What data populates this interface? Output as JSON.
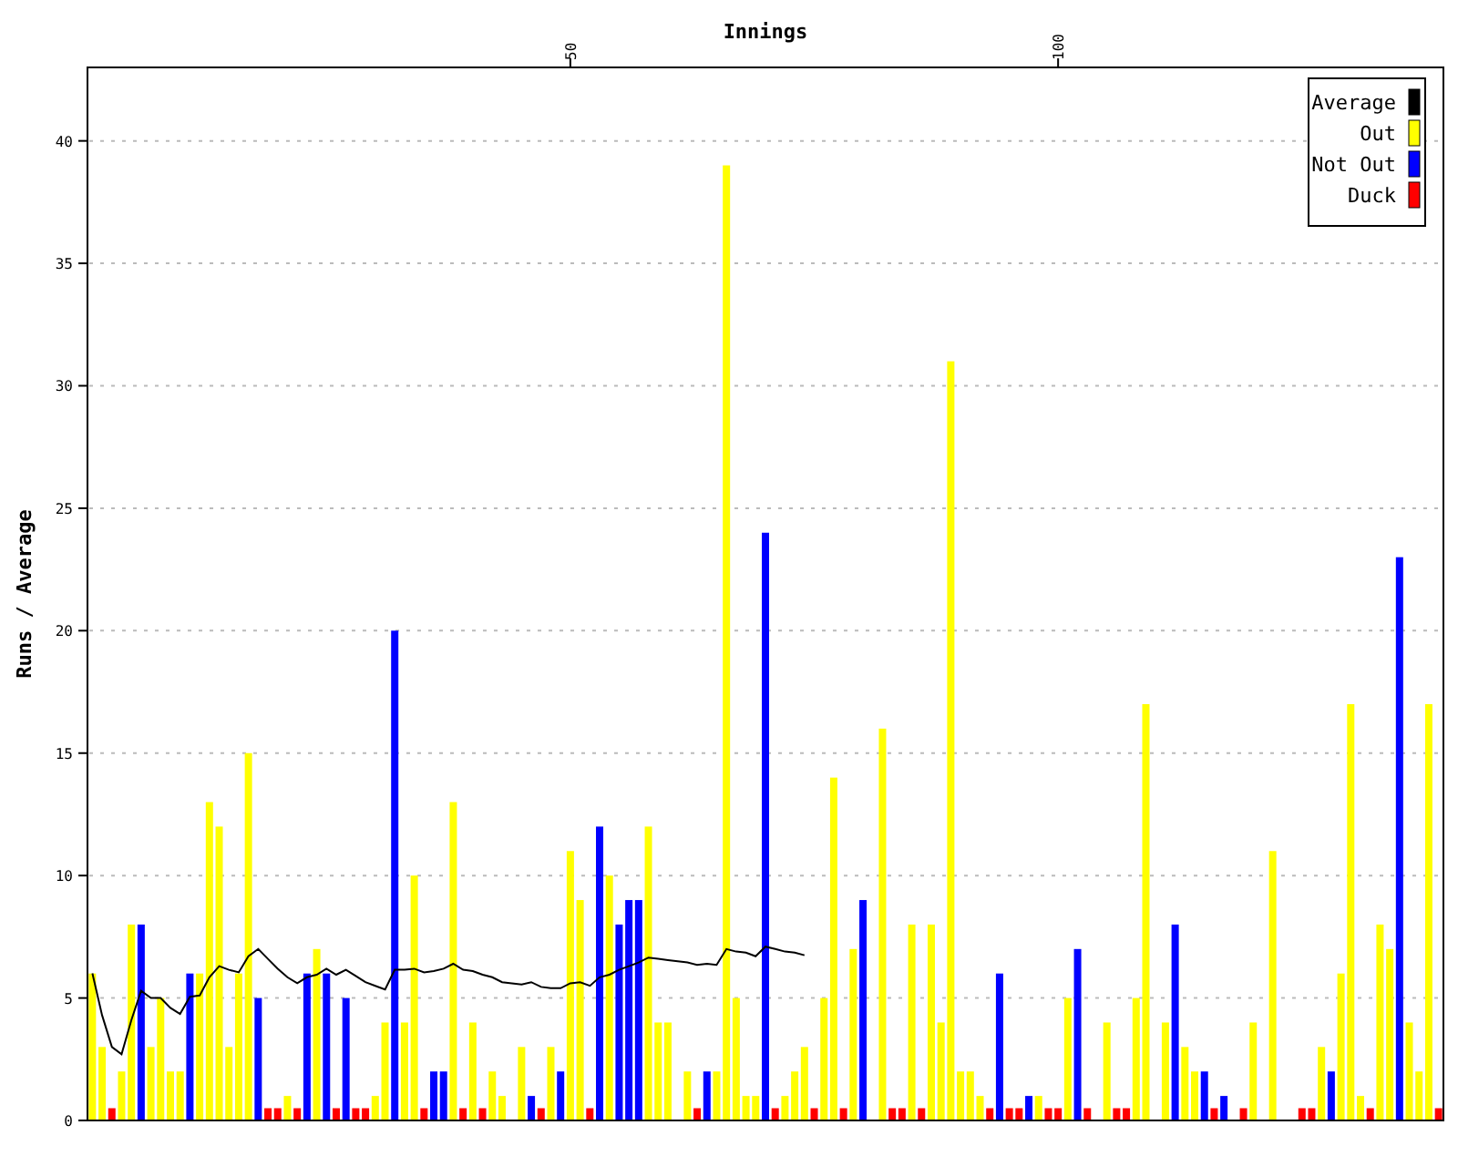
{
  "chart": {
    "chart_data": {
      "type": "bar",
      "xlabel": "Innings",
      "ylabel": "Runs / Average",
      "x": [
        1,
        2,
        3,
        4,
        5,
        6,
        7,
        8,
        9,
        10,
        11,
        12,
        13,
        14,
        15,
        16,
        17,
        18,
        19,
        20,
        21,
        22,
        23,
        24,
        25,
        26,
        27,
        28,
        29,
        30,
        31,
        32,
        33,
        34,
        35,
        36,
        37,
        38,
        39,
        40,
        41,
        42,
        43,
        45,
        46,
        47,
        48,
        49,
        50,
        51,
        52,
        53,
        54,
        55,
        56,
        57,
        58,
        59,
        60,
        62,
        63,
        64,
        65,
        66,
        67,
        68,
        69,
        70,
        71,
        72,
        73,
        74,
        75,
        76,
        77,
        78,
        79,
        80,
        82,
        83,
        84,
        85,
        86,
        87,
        88,
        89,
        90,
        91,
        92,
        93,
        94,
        95,
        96,
        97,
        98,
        99,
        100,
        101,
        102,
        103,
        105,
        106,
        107,
        108,
        109,
        111,
        112,
        113,
        114,
        115,
        116,
        117,
        119,
        120,
        122,
        125,
        126,
        127,
        128,
        129,
        130,
        131,
        132,
        133,
        134,
        135,
        136,
        137,
        138,
        139
      ],
      "xlim": [
        0.5,
        139.5
      ],
      "ylim": [
        0,
        43
      ],
      "xticks": [
        50,
        100
      ],
      "yticks": [
        0,
        5,
        10,
        15,
        20,
        25,
        30,
        35,
        40
      ],
      "grid": true,
      "legend": "upper right",
      "series": [
        {
          "name": "Average",
          "type": "line",
          "color": "#000000",
          "values": [
            6.0,
            4.3,
            3.0,
            2.7,
            4.1,
            5.3,
            5.0,
            5.0,
            4.6,
            4.35,
            5.05,
            5.1,
            5.85,
            6.3,
            6.15,
            6.05,
            6.7,
            7.0,
            6.6,
            6.2,
            5.85,
            5.6,
            5.85,
            5.95,
            6.2,
            5.95,
            6.15,
            5.9,
            5.65,
            5.5,
            5.35,
            6.15,
            6.15,
            6.2,
            6.05,
            6.1,
            6.2,
            6.4,
            6.15,
            6.1,
            5.95,
            5.85,
            5.65,
            5.55,
            5.65,
            5.45,
            5.4,
            5.4,
            5.6,
            5.65,
            5.5,
            5.85,
            5.95,
            6.15,
            6.3,
            6.45,
            6.65,
            6.6,
            6.55,
            6.45,
            6.35,
            6.4,
            6.35,
            7.0,
            6.9,
            6.85,
            6.7,
            7.1,
            7.0,
            6.9,
            6.85,
            6.75,
            null,
            null,
            null,
            null,
            null,
            null,
            null,
            null,
            null,
            null,
            null,
            null,
            null,
            null,
            null,
            null,
            null,
            null,
            null,
            null,
            null,
            null,
            null,
            null,
            null,
            null,
            null,
            null,
            null,
            null,
            null,
            null,
            null,
            null,
            null,
            null,
            null,
            null,
            null,
            null,
            null,
            null,
            null,
            null,
            null,
            null,
            null,
            null,
            null,
            null,
            null,
            null,
            null,
            null,
            null,
            null,
            null,
            null
          ]
        },
        {
          "name": "Out",
          "type": "bar",
          "color": "#ffff00",
          "values": [
            6,
            3,
            null,
            2,
            8,
            null,
            3,
            5,
            2,
            2,
            null,
            6,
            13,
            12,
            3,
            6,
            15,
            null,
            null,
            null,
            1,
            null,
            null,
            7,
            null,
            null,
            null,
            null,
            null,
            1,
            4,
            null,
            4,
            10,
            null,
            null,
            null,
            13,
            null,
            4,
            null,
            2,
            1,
            3,
            null,
            null,
            3,
            null,
            11,
            9,
            null,
            null,
            10,
            null,
            null,
            null,
            12,
            4,
            4,
            2,
            null,
            null,
            2,
            39,
            5,
            1,
            1,
            null,
            null,
            1,
            2,
            3,
            null,
            5,
            14,
            null,
            7,
            null,
            16,
            null,
            null,
            8,
            null,
            8,
            4,
            31,
            2,
            2,
            1,
            null,
            null,
            null,
            null,
            null,
            1,
            null,
            null,
            5,
            null,
            null,
            4,
            null,
            null,
            5,
            17,
            4,
            null,
            3,
            2,
            null,
            null,
            null,
            null,
            4,
            11,
            null,
            null,
            3,
            null,
            6,
            17,
            1,
            null,
            8,
            7,
            null,
            4,
            2,
            17,
            null
          ]
        },
        {
          "name": "Not Out",
          "type": "bar",
          "color": "#0000ff",
          "values": [
            null,
            null,
            null,
            null,
            null,
            8,
            null,
            null,
            null,
            null,
            6,
            null,
            null,
            null,
            null,
            null,
            null,
            5,
            null,
            null,
            null,
            null,
            6,
            null,
            6,
            null,
            5,
            null,
            null,
            null,
            null,
            20,
            null,
            null,
            null,
            2,
            2,
            null,
            null,
            null,
            null,
            null,
            null,
            null,
            1,
            null,
            null,
            2,
            null,
            null,
            null,
            12,
            null,
            8,
            9,
            9,
            null,
            null,
            null,
            null,
            null,
            2,
            null,
            null,
            null,
            null,
            null,
            24,
            null,
            null,
            null,
            null,
            null,
            null,
            null,
            null,
            null,
            9,
            null,
            null,
            null,
            null,
            null,
            null,
            null,
            null,
            null,
            null,
            null,
            null,
            6,
            null,
            null,
            1,
            null,
            null,
            null,
            null,
            7,
            null,
            null,
            null,
            null,
            null,
            null,
            null,
            8,
            null,
            null,
            2,
            null,
            1,
            null,
            null,
            null,
            null,
            null,
            null,
            2,
            null,
            null,
            null,
            null,
            null,
            null,
            23,
            null,
            null,
            null,
            null
          ]
        },
        {
          "name": "Duck",
          "type": "bar",
          "color": "#ff0000",
          "values": [
            null,
            null,
            0,
            null,
            null,
            null,
            null,
            null,
            null,
            null,
            null,
            null,
            null,
            null,
            null,
            null,
            null,
            null,
            0,
            0,
            null,
            0,
            null,
            null,
            null,
            0,
            null,
            0,
            0,
            null,
            null,
            null,
            null,
            null,
            0,
            null,
            null,
            null,
            0,
            null,
            0,
            null,
            null,
            null,
            null,
            0,
            null,
            null,
            null,
            null,
            0,
            null,
            null,
            null,
            null,
            null,
            null,
            null,
            null,
            null,
            0,
            null,
            null,
            null,
            null,
            null,
            null,
            null,
            0,
            null,
            null,
            null,
            0,
            null,
            null,
            0,
            null,
            null,
            null,
            0,
            0,
            null,
            0,
            null,
            null,
            null,
            null,
            null,
            null,
            0,
            null,
            0,
            0,
            null,
            null,
            0,
            0,
            null,
            null,
            0,
            null,
            0,
            0,
            null,
            null,
            null,
            null,
            null,
            null,
            null,
            0,
            null,
            0,
            null,
            null,
            0,
            0,
            null,
            null,
            null,
            null,
            null,
            0,
            null,
            null,
            null,
            null,
            null,
            null,
            0
          ]
        }
      ]
    }
  }
}
